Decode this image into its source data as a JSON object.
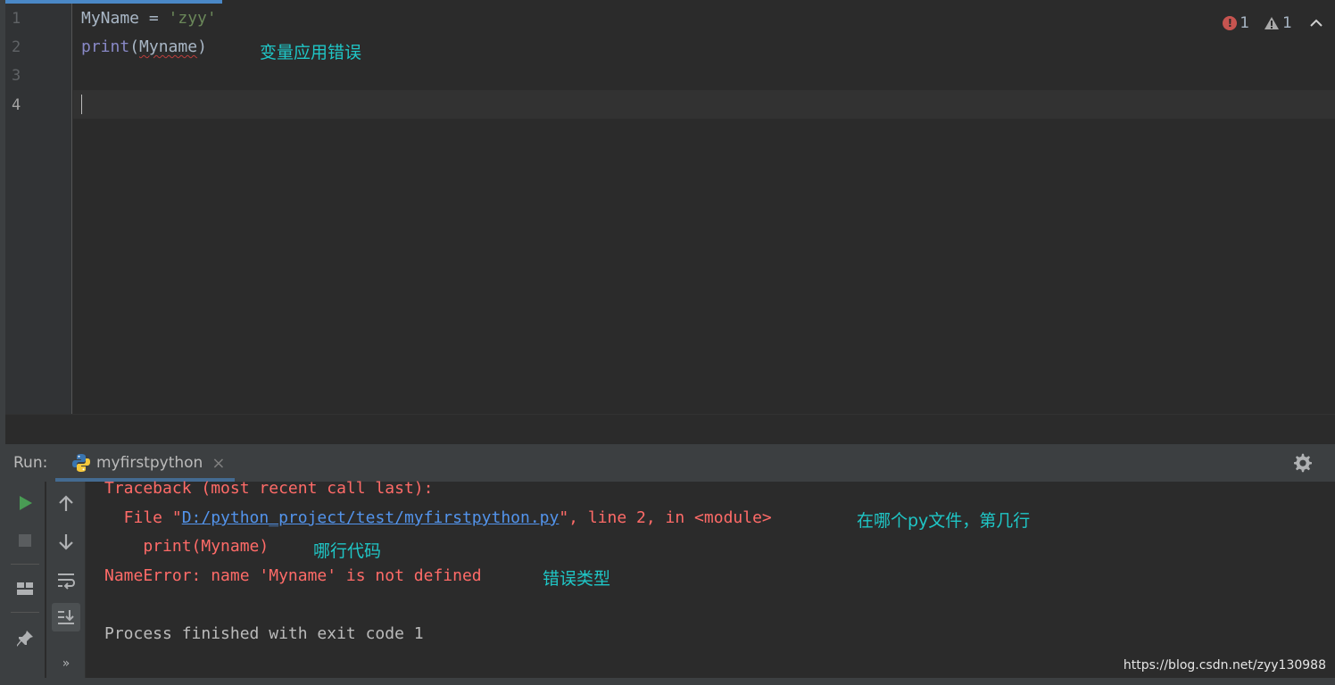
{
  "editor": {
    "line_numbers": [
      "1",
      "2",
      "3",
      "4"
    ],
    "lines": [
      {
        "var": "MyName",
        "op": " = ",
        "string": "'zyy'"
      },
      {
        "builtin": "print",
        "open": "(",
        "arg": "Myname",
        "close": ")"
      }
    ],
    "annotation": "变量应用错误"
  },
  "inspections": {
    "errors": "1",
    "warnings": "1"
  },
  "run": {
    "label": "Run:",
    "tab_name": "myfirstpython"
  },
  "console": {
    "traceback": "Traceback (most recent call last):",
    "file_prefix": "  File \"",
    "file_link": "D:/python_project/test/myfirstpython.py",
    "file_suffix": "\", line 2, in <module>",
    "code_line": "    print(Myname)",
    "error_line": "NameError: name 'Myname' is not defined",
    "exit_line": "Process finished with exit code 1",
    "annotation_file": "在哪个py文件，第几行",
    "annotation_code": "哪行代码",
    "annotation_error": "错误类型"
  },
  "watermark": "https://blog.csdn.net/zyy130988",
  "colors": {
    "background": "#2b2b2b",
    "panel": "#3c3f41",
    "error_text": "#ff6b68",
    "link": "#5394ec",
    "annotation": "#1fc6c6",
    "run_green": "#499c54"
  },
  "icons": [
    "python-icon",
    "close-icon",
    "settings-icon",
    "run-icon",
    "stop-icon",
    "arrow-up-icon",
    "arrow-down-icon",
    "soft-wrap-icon",
    "scroll-to-end-icon",
    "layout-icon",
    "pin-icon",
    "more-icon",
    "error-icon",
    "warning-icon",
    "chevron-up-icon"
  ]
}
